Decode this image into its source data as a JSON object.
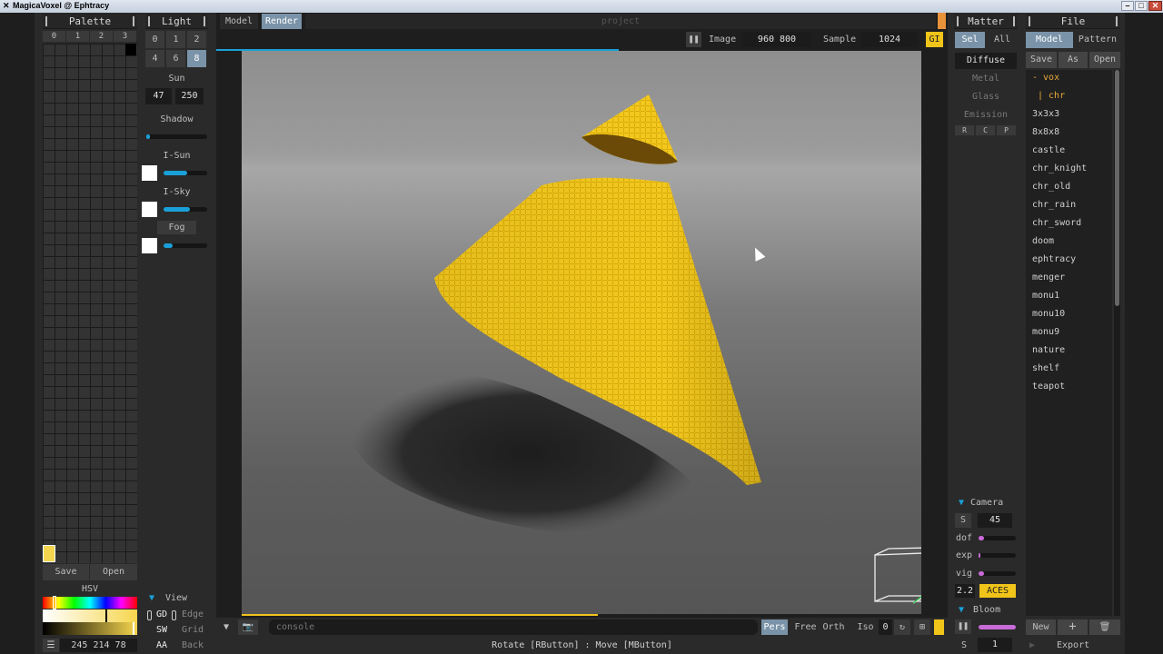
{
  "window": {
    "title": "MagicaVoxel @ Ephtracy"
  },
  "palette": {
    "title": "Palette",
    "tabs": [
      "0",
      "1",
      "2",
      "3"
    ],
    "save": "Save",
    "open": "Open",
    "mode": "HSV",
    "rgb": "245 214 78",
    "selected_color": "#f5d64e"
  },
  "light": {
    "title": "Light",
    "presets": [
      "0",
      "1",
      "2",
      "4",
      "6",
      "8"
    ],
    "selected_preset": "8",
    "sun_label": "Sun",
    "sun_values": [
      "47",
      "250"
    ],
    "shadow_label": "Shadow",
    "shadow": 0.05,
    "isun_label": "I-Sun",
    "isun": 0.55,
    "isky_label": "I-Sky",
    "isky": 0.6,
    "fog_label": "Fog",
    "fog": 0.2
  },
  "view": {
    "title": "View",
    "items": [
      {
        "k": "GD",
        "v": "Edge"
      },
      {
        "k": "SW",
        "v": "Grid"
      },
      {
        "k": "AA",
        "v": "Back"
      }
    ]
  },
  "modes": {
    "model": "Model",
    "render": "Render",
    "project": "project"
  },
  "render": {
    "image_label": "Image",
    "image_size": "960 800",
    "sample_label": "Sample",
    "sample": "1024",
    "gi": "GI",
    "progress": 0.55
  },
  "console": {
    "placeholder": "console",
    "proj_modes": [
      "Pers",
      "Free",
      "Orth",
      "Iso"
    ],
    "selected_proj": "Pers",
    "zero": "0"
  },
  "status": "Rotate [RButton] : Move [MButton]",
  "matter": {
    "title": "Matter",
    "sel": "Sel",
    "all": "All",
    "types": [
      "Diffuse",
      "Metal",
      "Glass",
      "Emission"
    ],
    "selected_type": "Diffuse",
    "rcp": [
      "R",
      "C",
      "P"
    ]
  },
  "camera": {
    "title": "Camera",
    "s": "S",
    "fov": "45",
    "dof_label": "dof",
    "dof": 0.15,
    "exp_label": "exp",
    "exp": 0,
    "vig_label": "vig",
    "vig": 0.15,
    "gamma": "2.2",
    "tonemap": "ACES"
  },
  "bloom": {
    "title": "Bloom",
    "s": "S",
    "value": "1",
    "level": 1.0
  },
  "file": {
    "title": "File",
    "model": "Model",
    "pattern": "Pattern",
    "save": "Save",
    "as": "As",
    "open": "Open",
    "folder": "- vox",
    "subfolder": "| chr",
    "items": [
      "3x3x3",
      "8x8x8",
      "castle",
      "chr_knight",
      "chr_old",
      "chr_rain",
      "chr_sword",
      "doom",
      "ephtracy",
      "menger",
      "monu1",
      "monu10",
      "monu9",
      "nature",
      "shelf",
      "teapot"
    ],
    "new": "New",
    "add": "+",
    "export": "Export"
  },
  "colors": {
    "accent": "#1aa0d8",
    "selected": "#7a93a8",
    "yellow": "#f0c419",
    "pink": "#c86bd8"
  }
}
